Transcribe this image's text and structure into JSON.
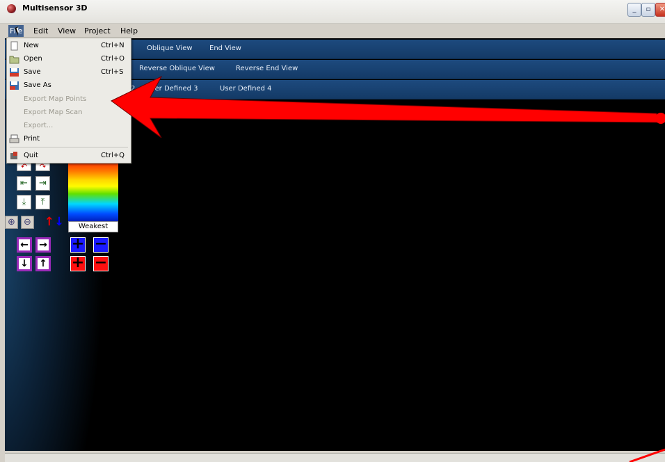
{
  "window": {
    "title": "Multisensor 3D",
    "icon": "app-globe-icon"
  },
  "menubar": {
    "items": [
      "File",
      "Edit",
      "View",
      "Project",
      "Help"
    ]
  },
  "file_menu": {
    "items": [
      {
        "label": "New",
        "shortcut": "Ctrl+N",
        "icon": "new-document-icon",
        "enabled": true
      },
      {
        "label": "Open",
        "shortcut": "Ctrl+O",
        "icon": "open-folder-icon",
        "enabled": true
      },
      {
        "label": "Save",
        "shortcut": "Ctrl+S",
        "icon": "save-disk-icon",
        "enabled": true
      },
      {
        "label": "Save As",
        "shortcut": "",
        "icon": "save-as-icon",
        "enabled": true
      },
      {
        "label": "Export Map Points",
        "shortcut": "",
        "icon": "",
        "enabled": false
      },
      {
        "label": "Export Map Scan",
        "shortcut": "",
        "icon": "",
        "enabled": false
      },
      {
        "label": "Export...",
        "shortcut": "",
        "icon": "",
        "enabled": false
      },
      {
        "label": "Print",
        "shortcut": "",
        "icon": "printer-icon",
        "enabled": true
      },
      {
        "label": "Quit",
        "shortcut": "Ctrl+Q",
        "icon": "quit-icon",
        "enabled": true
      }
    ]
  },
  "viewbars": {
    "row1": [
      "Oblique View",
      "End View"
    ],
    "row2": [
      "Reverse Oblique View",
      "Reverse End View"
    ],
    "row3": [
      "2",
      "User Defined 3",
      "User Defined 4"
    ]
  },
  "legend": {
    "weakest_label": "Weakest"
  },
  "controls": {
    "plus": "+",
    "minus": "−"
  },
  "colors": {
    "viewbar": "#1d4a7e",
    "annotation_arrow": "#ff0000",
    "plus_minus_blue": "#1a1aff",
    "plus_minus_red": "#ff1010"
  }
}
